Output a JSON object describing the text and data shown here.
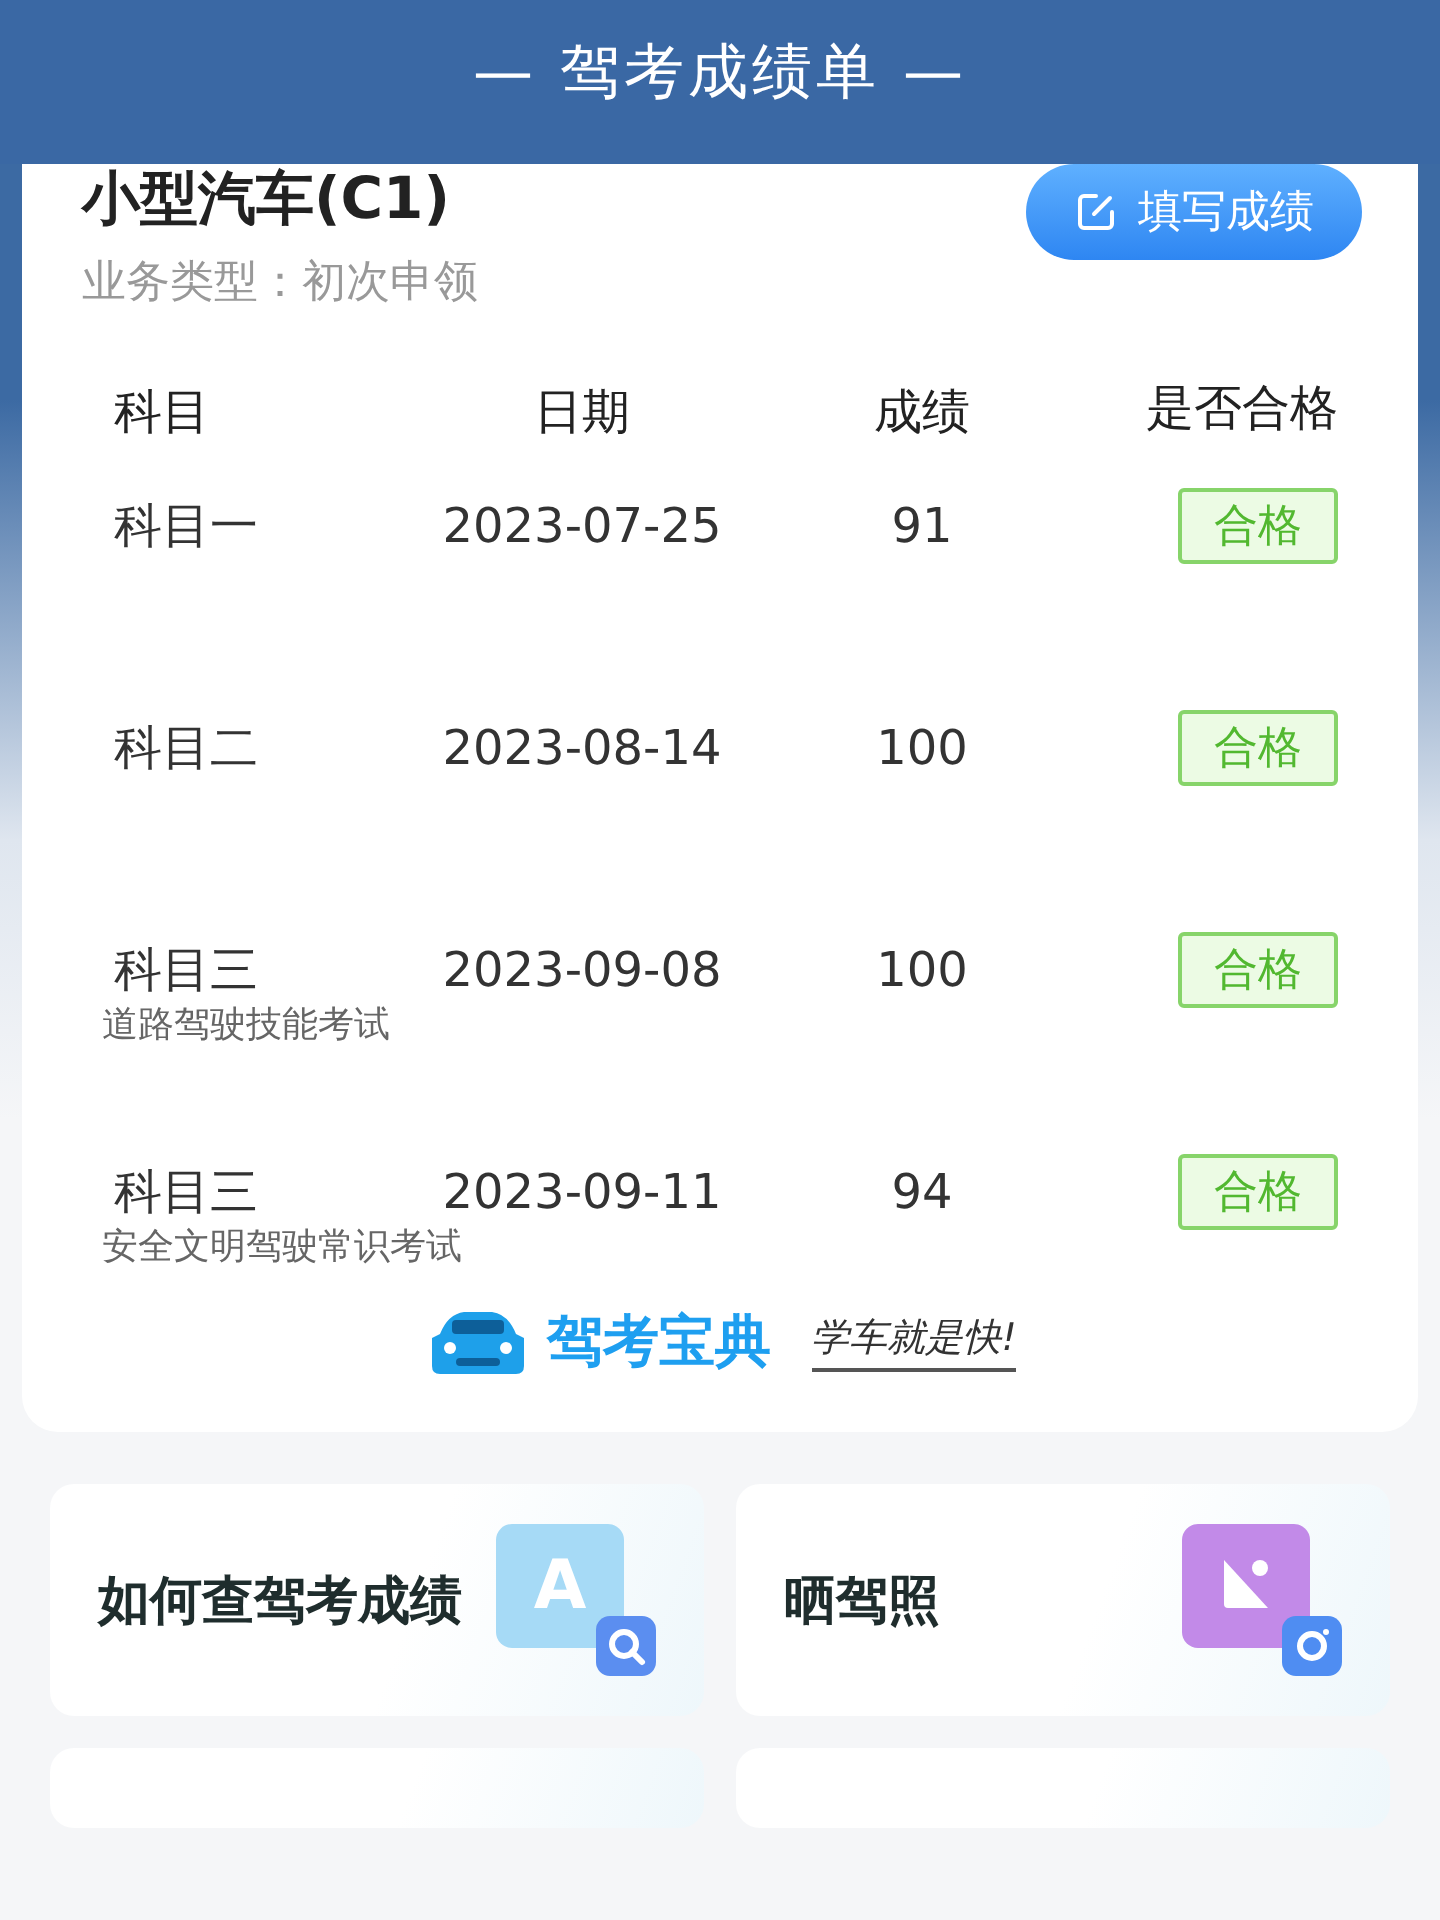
{
  "header": {
    "title": "— 驾考成绩单 —"
  },
  "card": {
    "vehicle": "小型汽车(C1)",
    "business": "业务类型：初次申领",
    "fill_button": "填写成绩",
    "columns": [
      "科目",
      "日期",
      "成绩",
      "是否合格"
    ],
    "rows": [
      {
        "subject": "科目一",
        "note": "",
        "date": "2023-07-25",
        "score": "91",
        "result": "合格",
        "passed": true
      },
      {
        "subject": "科目二",
        "note": "",
        "date": "2023-08-14",
        "score": "100",
        "result": "合格",
        "passed": true
      },
      {
        "subject": "科目三",
        "note": "道路驾驶技能考试",
        "date": "2023-09-08",
        "score": "100",
        "result": "合格",
        "passed": true
      },
      {
        "subject": "科目三",
        "note": "安全文明驾驶常识考试",
        "date": "2023-09-11",
        "score": "94",
        "result": "合格",
        "passed": true
      }
    ],
    "brand": {
      "name": "驾考宝典",
      "slogan": "学车就是快!"
    }
  },
  "tiles": [
    {
      "label": "如何查驾考成绩",
      "kind": "search",
      "icon_letter": "A"
    },
    {
      "label": "晒驾照",
      "kind": "photo"
    }
  ]
}
